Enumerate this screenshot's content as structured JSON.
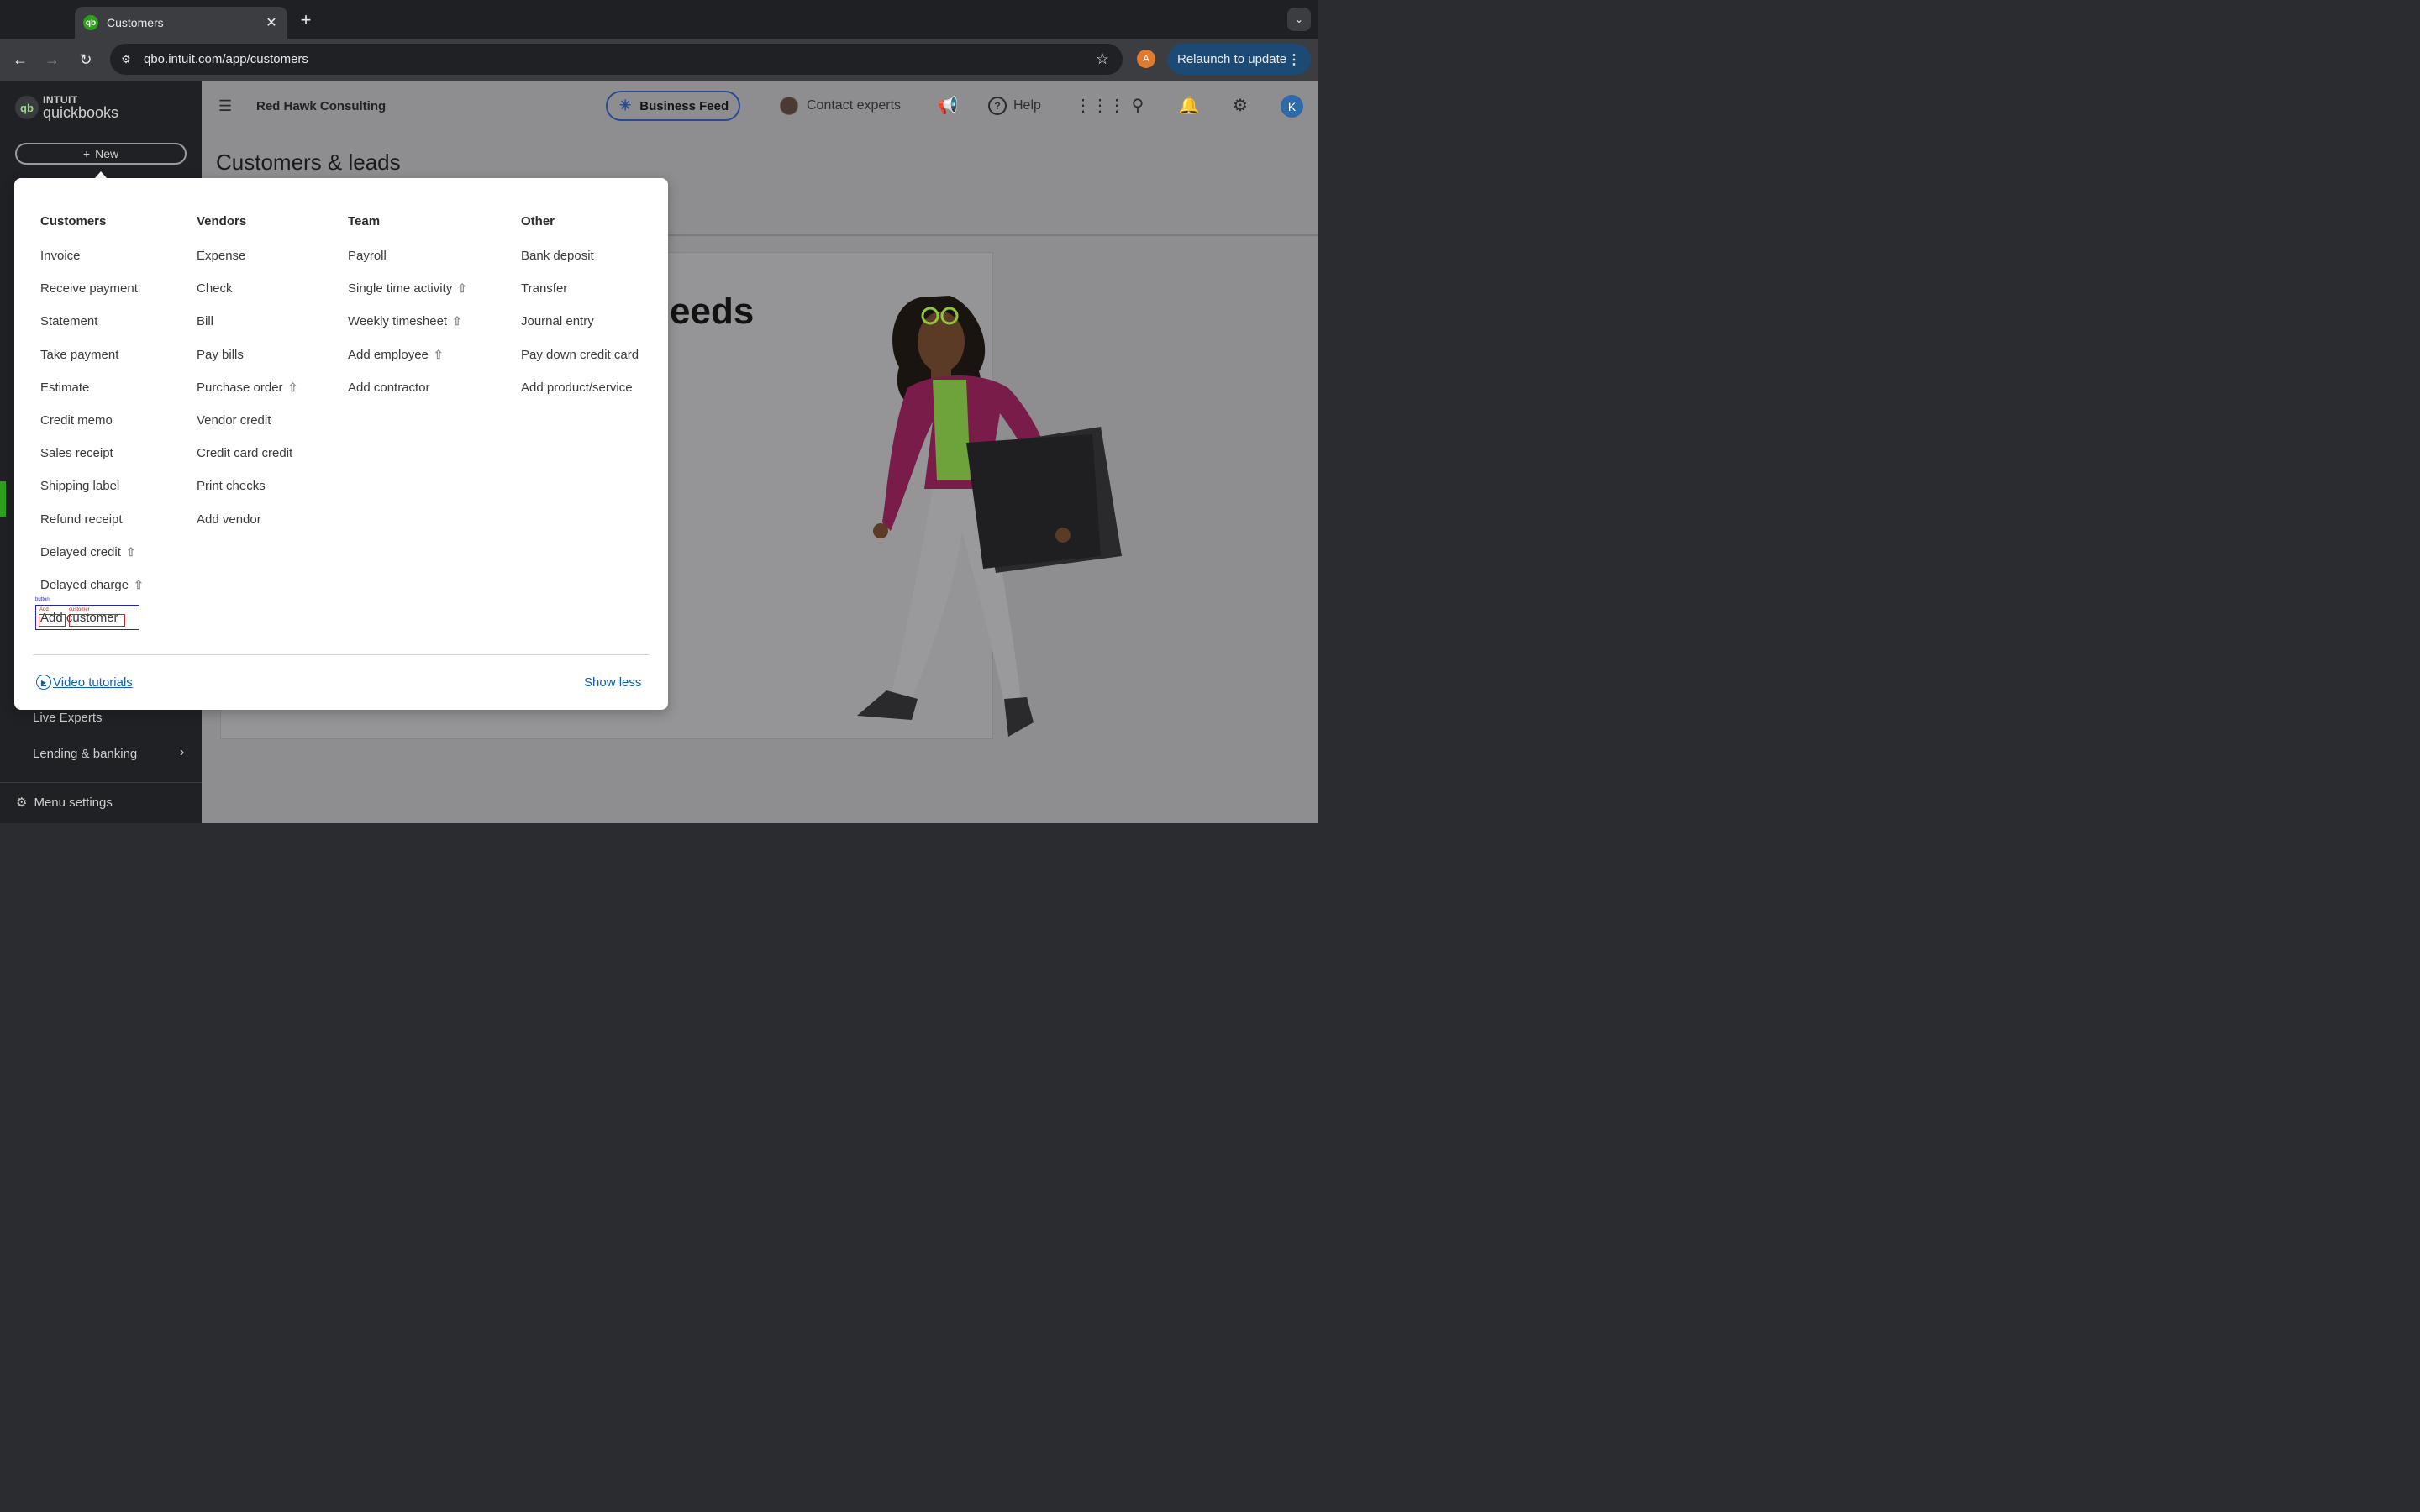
{
  "browser": {
    "tab_title": "Customers",
    "tab_favicon": "qb",
    "url": "qbo.intuit.com/app/customers",
    "profile_initial": "A",
    "relaunch_label": "Relaunch to update"
  },
  "app": {
    "logo_top": "INTUIT",
    "logo_bottom": "quickbooks",
    "new_label": "New",
    "company_name": "Red Hawk Consulting",
    "business_feed_label": "Business Feed",
    "contact_label": "Contact experts",
    "help_label": "Help",
    "user_initial": "K",
    "page_title": "Customers & leads",
    "card_heading_fragment": "eeds"
  },
  "sidebar": {
    "live_experts": "Live Experts",
    "lending_banking": "Lending & banking",
    "menu_settings": "Menu settings"
  },
  "new_menu": {
    "columns": [
      {
        "heading": "Customers",
        "items": [
          {
            "label": "Invoice",
            "upgrade": false
          },
          {
            "label": "Receive payment",
            "upgrade": false
          },
          {
            "label": "Statement",
            "upgrade": false
          },
          {
            "label": "Take payment",
            "upgrade": false
          },
          {
            "label": "Estimate",
            "upgrade": false
          },
          {
            "label": "Credit memo",
            "upgrade": false
          },
          {
            "label": "Sales receipt",
            "upgrade": false
          },
          {
            "label": "Shipping label",
            "upgrade": false
          },
          {
            "label": "Refund receipt",
            "upgrade": false
          },
          {
            "label": "Delayed credit",
            "upgrade": true
          },
          {
            "label": "Delayed charge",
            "upgrade": true
          },
          {
            "label": "Add customer",
            "upgrade": false
          }
        ]
      },
      {
        "heading": "Vendors",
        "items": [
          {
            "label": "Expense",
            "upgrade": false
          },
          {
            "label": "Check",
            "upgrade": false
          },
          {
            "label": "Bill",
            "upgrade": false
          },
          {
            "label": "Pay bills",
            "upgrade": false
          },
          {
            "label": "Purchase order",
            "upgrade": true
          },
          {
            "label": "Vendor credit",
            "upgrade": false
          },
          {
            "label": "Credit card credit",
            "upgrade": false
          },
          {
            "label": "Print checks",
            "upgrade": false
          },
          {
            "label": "Add vendor",
            "upgrade": false
          }
        ]
      },
      {
        "heading": "Team",
        "items": [
          {
            "label": "Payroll",
            "upgrade": false
          },
          {
            "label": "Single time activity",
            "upgrade": true
          },
          {
            "label": "Weekly timesheet",
            "upgrade": true
          },
          {
            "label": "Add employee",
            "upgrade": true
          },
          {
            "label": "Add contractor",
            "upgrade": false
          }
        ]
      },
      {
        "heading": "Other",
        "items": [
          {
            "label": "Bank deposit",
            "upgrade": false
          },
          {
            "label": "Transfer",
            "upgrade": false
          },
          {
            "label": "Journal entry",
            "upgrade": false
          },
          {
            "label": "Pay down credit card",
            "upgrade": false
          },
          {
            "label": "Add product/service",
            "upgrade": false
          }
        ]
      }
    ],
    "debug_labels": {
      "outer": "button",
      "word_a": "Add",
      "word_b": "customer"
    },
    "video_tutorials": "Video tutorials",
    "show_less": "Show less"
  },
  "colors": {
    "accent_green": "#2ca01c",
    "link_blue": "#0d5fb4",
    "business_feed_border": "#2a4a8f",
    "relaunch_bg": "#1c4a75",
    "overlay": "#8e8e90"
  },
  "icons": [
    "qb-favicon",
    "close-icon",
    "plus-icon",
    "chevron-down-icon",
    "back-arrow-icon",
    "forward-arrow-icon",
    "reload-icon",
    "site-info-icon",
    "star-icon",
    "kebab-menu-icon",
    "collapse-menu-icon",
    "business-feed-icon",
    "megaphone-icon",
    "help-icon",
    "app-grid-icon",
    "search-icon",
    "bell-icon",
    "gear-icon",
    "upgrade-arrow-icon",
    "play-circle-icon"
  ]
}
